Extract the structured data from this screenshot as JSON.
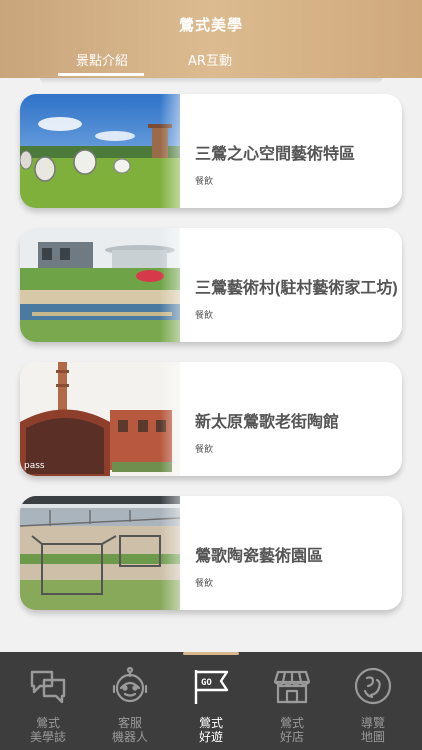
{
  "header": {
    "title": "鶯式美學",
    "tabs": [
      {
        "label": "景點介紹",
        "active": true
      },
      {
        "label": "AR互動",
        "active": false
      }
    ]
  },
  "cards": [
    {
      "title": "三鶯之心空間藝術特區",
      "subtitle": "餐飲"
    },
    {
      "title": "三鶯藝術村(駐村藝術家工坊)",
      "subtitle": "餐飲"
    },
    {
      "title": "新太原鶯歌老街陶館",
      "subtitle": "餐飲",
      "image_watermark": "pass"
    },
    {
      "title": "鶯歌陶瓷藝術園區",
      "subtitle": "餐飲"
    }
  ],
  "tabbar": {
    "items": [
      {
        "label_line1": "鶯式",
        "label_line2": "美學誌",
        "icon": "chat-bubbles-icon",
        "active": false
      },
      {
        "label_line1": "客服",
        "label_line2": "機器人",
        "icon": "robot-icon",
        "active": false
      },
      {
        "label_line1": "鶯式",
        "label_line2": "好遊",
        "icon": "go-flag-icon",
        "icon_text": "GO",
        "active": true
      },
      {
        "label_line1": "鶯式",
        "label_line2": "好店",
        "icon": "shop-icon",
        "active": false
      },
      {
        "label_line1": "導覽",
        "label_line2": "地圖",
        "icon": "map-compass-icon",
        "active": false
      }
    ]
  },
  "colors": {
    "header_start": "#c9a57b",
    "header_end": "#dcbb90",
    "tabbar_bg": "#3d3d3d",
    "tabbar_active": "#ffffff",
    "tabbar_inactive": "#9a9a9a",
    "accent_indicator": "#d8b98e"
  }
}
